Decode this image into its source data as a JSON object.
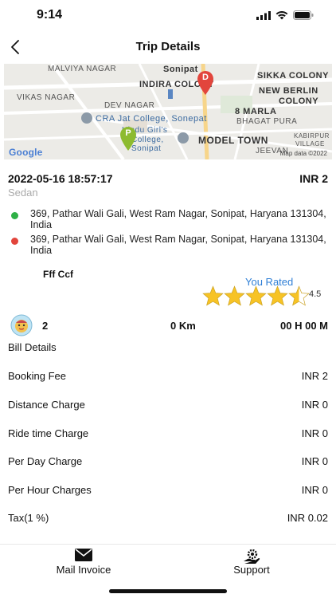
{
  "status_bar": {
    "time": "9:14"
  },
  "nav": {
    "title": "Trip Details"
  },
  "map": {
    "labels": {
      "sonipat": "Sonipat",
      "malviya_nagar": "MALVIYA NAGAR",
      "indira_colony": "INDIRA COLONY",
      "sikka_colony": "SIKKA COLONY",
      "new_berlin": "NEW BERLIN",
      "colony": "COLONY",
      "vikas_nagar": "VIKAS NAGAR",
      "dev_nagar": "DEV NAGAR",
      "eight_marla": "8 MARLA",
      "bhagat_pura": "BHAGAT PURA",
      "cra_college": "CRA Jat College, Sonepat",
      "girls_college_1": "Hindu Girl's",
      "girls_college_2": "College,",
      "girls_college_3": "Sonipat",
      "model_town": "MODEL TOWN",
      "kabirpur": "KABIRPUR",
      "village": "VILLAGE",
      "jeevan": "JEEVAN",
      "google": "Google",
      "copyright": "Map data ©2022",
      "pin_drop": "D",
      "pin_pickup": "P"
    }
  },
  "trip": {
    "date": "2022-05-16 18:57:17",
    "amount": "INR 2",
    "vehicle": "Sedan",
    "pickup": "369, Pathar Wali Gali, West Ram Nagar, Sonipat, Haryana 131304, India",
    "drop": "369, Pathar Wali Gali, West Ram Nagar, Sonipat, Haryana 131304, India"
  },
  "driver": {
    "name": "Fff Ccf"
  },
  "rating": {
    "label": "You Rated",
    "value": "4.5",
    "score": 4.5,
    "max": 5
  },
  "summary": {
    "count": "2",
    "distance": "0 Km",
    "duration": "00 H 00 M"
  },
  "bill": {
    "title": "Bill Details",
    "rows": [
      {
        "label": "Booking Fee",
        "value": "INR 2"
      },
      {
        "label": "Distance Charge",
        "value": "INR 0"
      },
      {
        "label": "Ride time Charge",
        "value": "INR 0"
      },
      {
        "label": "Per Day Charge",
        "value": "INR 0"
      },
      {
        "label": "Per Hour Charges",
        "value": "INR 0"
      },
      {
        "label": "Tax(1 %)",
        "value": "INR 0.02"
      }
    ]
  },
  "bottom_bar": {
    "mail_invoice": "Mail Invoice",
    "support": "Support"
  },
  "colors": {
    "pickup_dot": "#2eb046",
    "drop_dot": "#e2453c",
    "accent_blue": "#2f7fd6",
    "star": "#f7c325"
  },
  "icons": {
    "back": "chevron-left-icon",
    "mail": "envelope-icon",
    "support": "gear-hand-icon",
    "avatar": "driver-avatar-icon"
  }
}
